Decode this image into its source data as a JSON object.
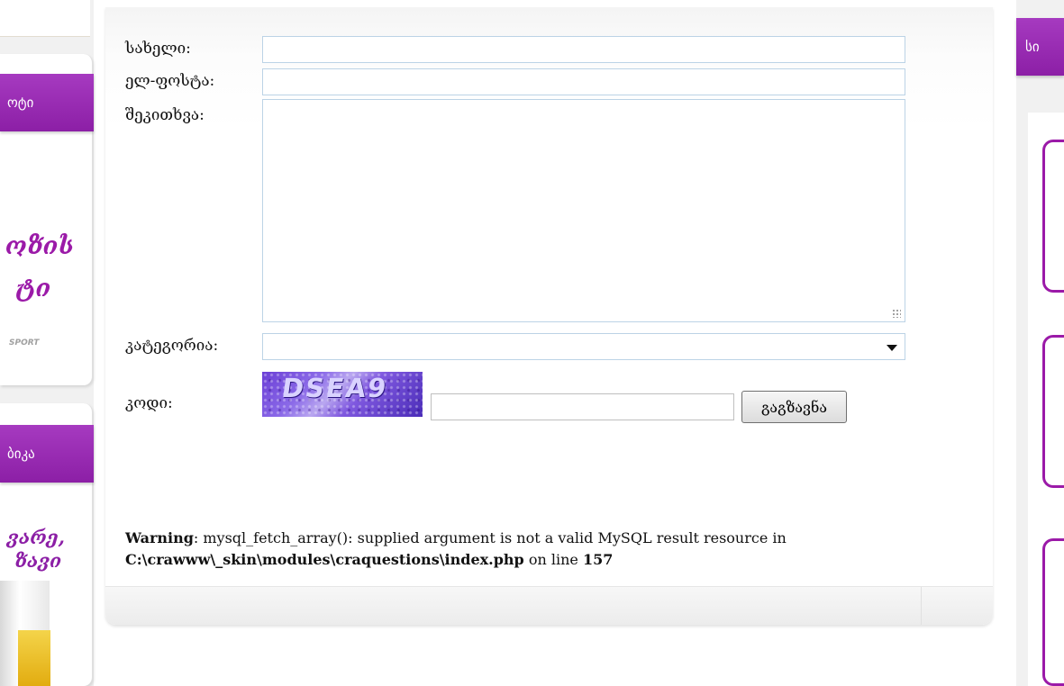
{
  "left_sidebar": {
    "tab1_label": "ოტი",
    "tab2_label": "ბიკა",
    "promo1_line1": "ოზის",
    "promo1_line2": "ტი",
    "promo1_brand": "SPORT",
    "promo2_line1": "ვარე,",
    "promo2_line2": "ზავი",
    "accent_color": "#9b1aa8"
  },
  "form": {
    "name_label": "სახელი:",
    "email_label": "ელ-ფოსტა:",
    "question_label": "შეკითხვა:",
    "category_label": "კატეგორია:",
    "category_value": "",
    "code_label": "კოდი:",
    "captcha_text": "DSEA9",
    "submit_label": "გაგზავნა",
    "name_value": "",
    "email_value": "",
    "question_value": "",
    "code_value": ""
  },
  "warning": {
    "prefix": "Warning",
    "message": ": mysql_fetch_array(): supplied argument is not a valid MySQL result resource in",
    "path": "C:\\crawww\\_skin\\modules\\craquestions\\index.php",
    "line_text": " on line ",
    "line_number": "157"
  },
  "right_sidebar": {
    "tab_label": "სი"
  }
}
